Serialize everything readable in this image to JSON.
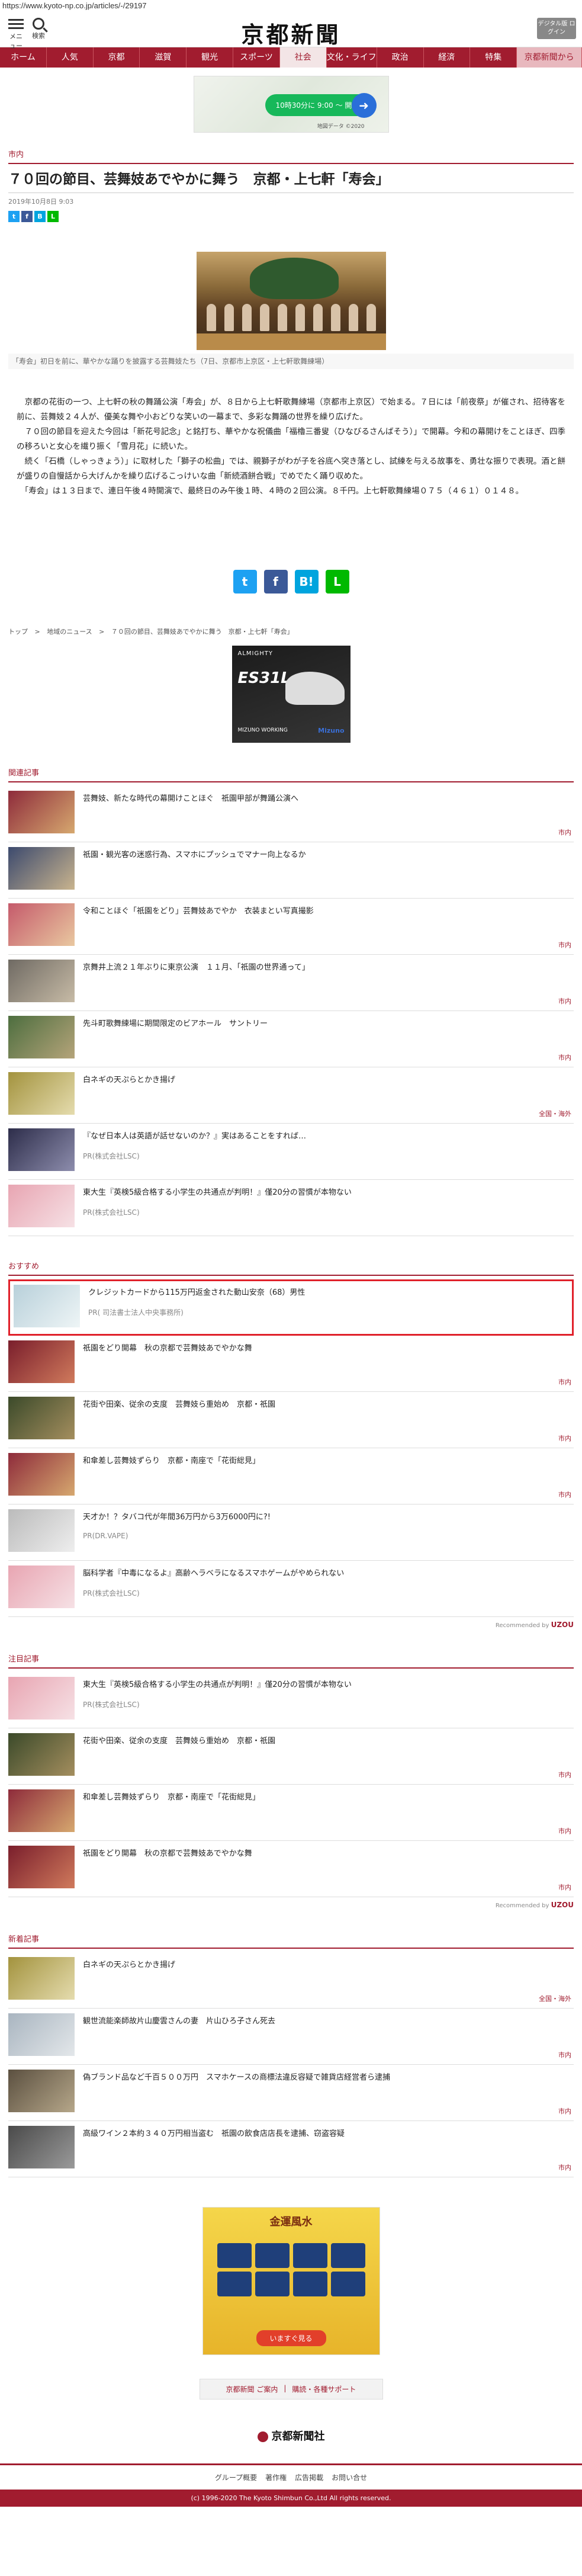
{
  "browser": {
    "url": "https://www.kyoto-np.co.jp/articles/-/29197"
  },
  "header": {
    "menu_label": "メニュー",
    "search_label": "検索",
    "logo": "京都新聞",
    "digital_label": "デジタル版 ログイン"
  },
  "nav": [
    "ホーム",
    "人気",
    "京都",
    "滋賀",
    "観光",
    "スポーツ",
    "社会",
    "文化・ライフ",
    "政治",
    "経済",
    "特集",
    "京都新聞から"
  ],
  "top_ad": {
    "pill_text": "10時30分に 9:00 〜 開店",
    "credit": "地図データ ©2020"
  },
  "article": {
    "section": "市内",
    "title": "７０回の節目、芸舞妓あでやかに舞う　京都・上七軒「寿会」",
    "date": "2019年10月8日 9:03",
    "caption": "「寿会」初日を前に、華やかな踊りを披露する芸舞妓たち（7日、京都市上京区・上七軒歌舞練場）",
    "paragraphs": [
      "　京都の花街の一つ、上七軒の秋の舞踊公演「寿会」が、８日から上七軒歌舞練場（京都市上京区）で始まる。７日には「前夜祭」が催され、招待客を前に、芸舞妓２４人が、優美な舞や小おどりな笑いの一幕まで、多彩な舞踊の世界を繰り広げた。",
      "　７０回の節目を迎えた今回は「新花号記念」と銘打ち、華やかな祝儀曲「福櫓三番叟（ひなびるさんばそう）」で開幕。今和の幕開けをことほぎ、四季の移ろいと女心を繊り振く「雪月花」に続いた。",
      "　続く「石橋（しゃっきょう）」に取材した「獅子の松曲」では、親獅子がわが子を谷底へ突き落とし、試練を与える故事を、勇壮な振りで表現。酒と餅が盛りの自慢話から大げんかを繰り広げるこっけいな曲「新続酒餅合戦」でめでたく踊り収めた。",
      "　「寿会」は１３日まで、連日午後４時開演で、最終日のみ午後１時、４時の２回公演。８千円。上七軒歌舞練場０７５（４６１）０１４８。"
    ]
  },
  "breadcrumb": [
    "トップ",
    ">",
    "地域のニュース",
    ">",
    "７０回の節目、芸舞妓あでやかに舞う　京都・上七軒「寿会」"
  ],
  "shoe_ad": {
    "brand": "ALMIGHTY",
    "name": "ES31L",
    "model": "MIZUNO WORKING",
    "maker": "Mizuno"
  },
  "related": {
    "label": "関連記事",
    "items": [
      {
        "title": "芸舞妓、新たな時代の幕開けことほぐ　祇園甲部が舞踊公演へ",
        "tag": "市内",
        "thumb": "t1"
      },
      {
        "title": "祇園・観光客の迷惑行為、スマホにプッシュでマナー向上なるか",
        "tag": "",
        "thumb": "t2"
      },
      {
        "title": "令和ことほぐ「祇園をどり」芸舞妓あでやか　衣装まとい写真撮影",
        "tag": "市内",
        "thumb": "t3"
      },
      {
        "title": "京舞井上流２１年ぶりに東京公演　１１月、「祇園の世界通って」",
        "tag": "市内",
        "thumb": "t4"
      },
      {
        "title": "先斗町歌舞練場に期間限定のビアホール　サントリー",
        "tag": "市内",
        "thumb": "t5"
      },
      {
        "title": "白ネギの天ぷらとかき揚げ",
        "tag": "全国・海外",
        "thumb": "t6"
      },
      {
        "title": "『なぜ日本人は英語が話せないのか？』実はあることをすれば…",
        "pr": "PR(株式会社LSC)",
        "thumb": "t7"
      },
      {
        "title": "東大生『英検5級合格する小学生の共通点が判明！』僅20分の習慣が本物ない",
        "pr": "PR(株式会社LSC)",
        "thumb": "t8"
      }
    ]
  },
  "recommend": {
    "label": "おすすめ",
    "items": [
      {
        "title": "クレジットカードから115万円返金された動山安奈（68）男性",
        "pr": "PR( 司法書士法人中央事務所)",
        "thumb": "t9",
        "highlight": true
      },
      {
        "title": "祇園をどり開幕　秋の京都で芸舞妓あでやかな舞",
        "tag": "市内",
        "thumb": "t10"
      },
      {
        "title": "花街や田楽、従余の支度　芸舞妓ら重始め　京都・祇園",
        "tag": "市内",
        "thumb": "t11"
      },
      {
        "title": "和傘差し芸舞妓ずらり　京都・南座で「花街総見」",
        "tag": "市内",
        "thumb": "t1"
      },
      {
        "title": "天才か！？タバコ代が年間36万円から3万6000円に?!",
        "pr": "PR(DR.VAPE)",
        "thumb": "t12"
      },
      {
        "title": "脳科学者『中毒になるよ』高齢ヘラベラになるスマホゲームがやめられない",
        "pr": "PR(株式会社LSC)",
        "thumb": "t8"
      }
    ],
    "recommended_by": "Recommended by",
    "uzou": "UZOU"
  },
  "attention": {
    "label": "注目記事",
    "items": [
      {
        "title": "東大生『英検5級合格する小学生の共通点が判明！』僅20分の習慣が本物ない",
        "pr": "PR(株式会社LSC)",
        "thumb": "t8"
      },
      {
        "title": "花街や田楽、従余の支度　芸舞妓ら重始め　京都・祇園",
        "tag": "市内",
        "thumb": "t11"
      },
      {
        "title": "和傘差し芸舞妓ずらり　京都・南座で「花街総見」",
        "tag": "市内",
        "thumb": "t1"
      },
      {
        "title": "祇園をどり開幕　秋の京都で芸舞妓あでやかな舞",
        "tag": "市内",
        "thumb": "t10"
      }
    ],
    "recommended_by": "Recommended by",
    "uzou": "UZOU"
  },
  "latest": {
    "label": "新着記事",
    "items": [
      {
        "title": "白ネギの天ぷらとかき揚げ",
        "tag": "全国・海外",
        "thumb": "t6"
      },
      {
        "title": "観世流能楽師故片山慶雲さんの妻　片山ひろ子さん死去",
        "tag": "市内",
        "thumb": "t13"
      },
      {
        "title": "偽ブランド品など千百５００万円　スマホケースの商標法違反容疑で雑貨店経営者ら逮捕",
        "tag": "市内",
        "thumb": "t14"
      },
      {
        "title": "高級ワイン２本約３４０万円相当盗む　祇園の飲食店店長を逮捕、窃盗容疑",
        "tag": "市内",
        "thumb": "t15"
      }
    ]
  },
  "zodiac_ad": {
    "headline": "金運風水",
    "cta": "いますぐ見る"
  },
  "footer": {
    "box_links": [
      "京都新聞 ご案内",
      "|",
      "購読・各種サポート"
    ],
    "logo": "京都新聞社",
    "nav": [
      "グループ概要",
      "著作権",
      "広告掲載",
      "お問い合せ"
    ],
    "copyright": "(c) 1996-2020 The Kyoto Shimbun Co.,Ltd All rights reserved."
  },
  "colors": {
    "brand": "#a11c2f",
    "highlight": "#e0202a"
  }
}
